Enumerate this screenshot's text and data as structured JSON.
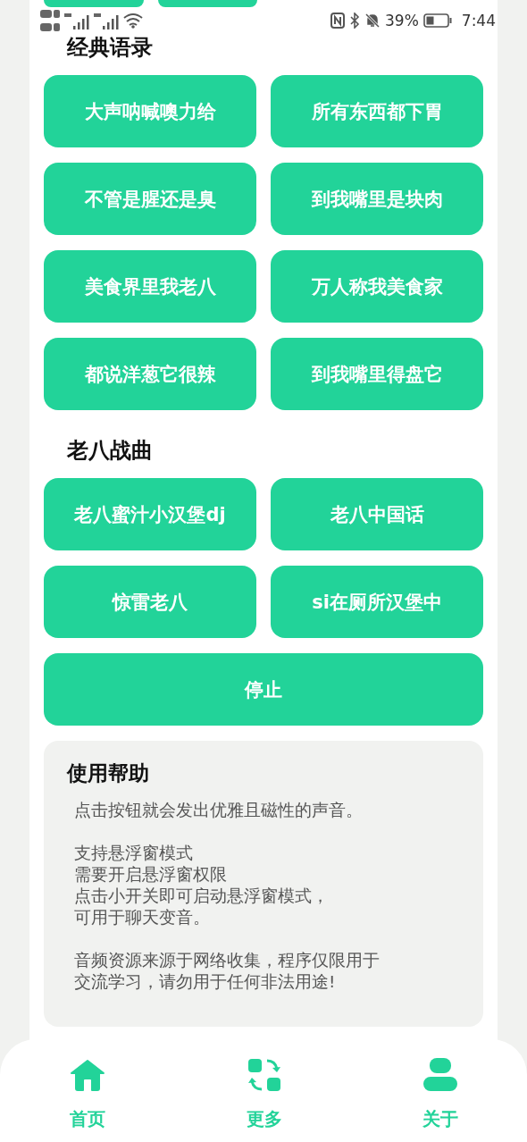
{
  "status_bar": {
    "battery_text": "39%",
    "time": "7:44"
  },
  "sections": [
    {
      "title": "经典语录",
      "buttons": [
        "大声呐喊噢力给",
        "所有东西都下胃",
        "不管是腥还是臭",
        "到我嘴里是块肉",
        "美食界里我老八",
        "万人称我美食家",
        "都说洋葱它很辣",
        "到我嘴里得盘它"
      ]
    },
    {
      "title": "老八战曲",
      "buttons": [
        "老八蜜汁小汉堡dj",
        "老八中国话",
        "惊雷老八",
        "si在厕所汉堡中"
      ]
    }
  ],
  "stop_button": "停止",
  "help": {
    "title": "使用帮助",
    "paragraphs": [
      [
        "点击按钮就会发出优雅且磁性的声音。"
      ],
      [
        "支持悬浮窗模式",
        "需要开启悬浮窗权限",
        "点击小开关即可启动悬浮窗模式，",
        "可用于聊天变音。"
      ],
      [
        "音频资源来源于网络收集，程序仅限用于",
        "交流学习，请勿用于任何非法用途!"
      ]
    ]
  },
  "nav": [
    {
      "kind": "home",
      "label": "首页"
    },
    {
      "kind": "more",
      "label": "更多"
    },
    {
      "kind": "about",
      "label": "关于"
    }
  ]
}
